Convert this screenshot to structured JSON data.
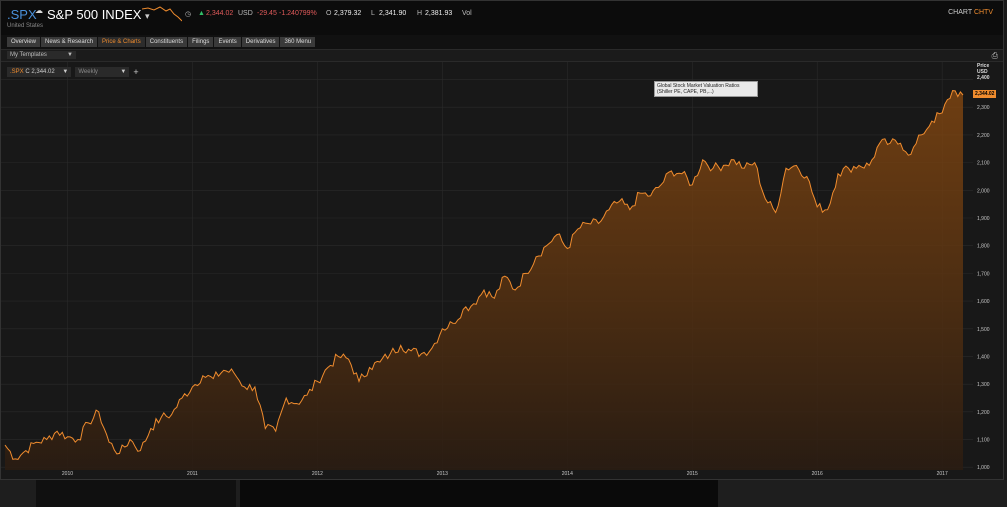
{
  "header": {
    "ric": ".SPX",
    "name": "S&P 500 INDEX",
    "country": "United States",
    "last": "2,344.02",
    "currency": "USD",
    "net_change": "-29.45",
    "pct_change": "-1.240799%",
    "open_label": "O",
    "open": "2,379.32",
    "low_label": "L",
    "low": "2,341.90",
    "high_label": "H",
    "high": "2,381.93",
    "vol_label": "Vol",
    "chart_label": "CHART",
    "chart_code": "CHTV"
  },
  "tabs": [
    {
      "label": "Overview"
    },
    {
      "label": "News & Research"
    },
    {
      "label": "Price & Charts",
      "active": true
    },
    {
      "label": "Constituents"
    },
    {
      "label": "Filings"
    },
    {
      "label": "Events"
    },
    {
      "label": "Derivatives"
    },
    {
      "label": "360 Menu"
    }
  ],
  "template_select": "My Templates",
  "toolbar": {
    "series_ric": ".SPX",
    "series_value": "C 2,344.02",
    "interval": "Weekly",
    "add": "+"
  },
  "tooltip": "Global Stock Market Valuation Ratios (Shiller PE, CAPE, PB,...)",
  "axis_head": {
    "line1": "Price",
    "line2": "USD",
    "line3": "2,400"
  },
  "price_tag": "2,344.02",
  "colors": {
    "line": "#f08c2e",
    "up": "#32c067",
    "down": "#e05a5a",
    "ric": "#4a90d9"
  },
  "chart_data": {
    "type": "area",
    "series": [
      {
        "name": ".SPX",
        "values_note": "weekly close"
      }
    ],
    "x": [
      "2009-07",
      "2009-08",
      "2009-09",
      "2009-10",
      "2009-11",
      "2009-12",
      "2010-01",
      "2010-02",
      "2010-03",
      "2010-04",
      "2010-05",
      "2010-06",
      "2010-07",
      "2010-08",
      "2010-09",
      "2010-10",
      "2010-11",
      "2010-12",
      "2011-01",
      "2011-02",
      "2011-03",
      "2011-04",
      "2011-05",
      "2011-06",
      "2011-07",
      "2011-08",
      "2011-09",
      "2011-10",
      "2011-11",
      "2011-12",
      "2012-01",
      "2012-02",
      "2012-03",
      "2012-04",
      "2012-05",
      "2012-06",
      "2012-07",
      "2012-08",
      "2012-09",
      "2012-10",
      "2012-11",
      "2012-12",
      "2013-01",
      "2013-02",
      "2013-03",
      "2013-04",
      "2013-05",
      "2013-06",
      "2013-07",
      "2013-08",
      "2013-09",
      "2013-10",
      "2013-11",
      "2013-12",
      "2014-01",
      "2014-02",
      "2014-03",
      "2014-04",
      "2014-05",
      "2014-06",
      "2014-07",
      "2014-08",
      "2014-09",
      "2014-10",
      "2014-11",
      "2014-12",
      "2015-01",
      "2015-02",
      "2015-03",
      "2015-04",
      "2015-05",
      "2015-06",
      "2015-07",
      "2015-08",
      "2015-09",
      "2015-10",
      "2015-11",
      "2015-12",
      "2016-01",
      "2016-02",
      "2016-03",
      "2016-04",
      "2016-05",
      "2016-06",
      "2016-07",
      "2016-08",
      "2016-09",
      "2016-10",
      "2016-11",
      "2016-12",
      "2017-01",
      "2017-02",
      "2017-03"
    ],
    "values": [
      1080,
      1030,
      1060,
      1090,
      1100,
      1130,
      1110,
      1100,
      1160,
      1200,
      1090,
      1050,
      1100,
      1060,
      1140,
      1180,
      1190,
      1250,
      1290,
      1330,
      1320,
      1350,
      1340,
      1290,
      1290,
      1140,
      1130,
      1250,
      1230,
      1260,
      1310,
      1360,
      1400,
      1390,
      1310,
      1360,
      1380,
      1410,
      1440,
      1420,
      1410,
      1430,
      1500,
      1520,
      1570,
      1590,
      1640,
      1610,
      1690,
      1640,
      1700,
      1760,
      1800,
      1840,
      1790,
      1860,
      1880,
      1880,
      1930,
      1960,
      1930,
      1990,
      1980,
      2020,
      2070,
      2060,
      2020,
      2110,
      2080,
      2090,
      2110,
      2080,
      2100,
      1970,
      1920,
      2080,
      2090,
      2050,
      1940,
      1930,
      2060,
      2080,
      2090,
      2090,
      2170,
      2170,
      2170,
      2130,
      2200,
      2250,
      2280,
      2360,
      2344
    ],
    "x_tick_labels": [
      "2010",
      "2011",
      "2012",
      "2013",
      "2014",
      "2015",
      "2016",
      "2017"
    ],
    "y_tick_labels": [
      "1,000",
      "1,100",
      "1,200",
      "1,300",
      "1,400",
      "1,500",
      "1,600",
      "1,700",
      "1,800",
      "1,900",
      "2,000",
      "2,100",
      "2,200",
      "2,300",
      "2,400"
    ],
    "ylim": [
      990,
      2420
    ],
    "grid": true
  }
}
